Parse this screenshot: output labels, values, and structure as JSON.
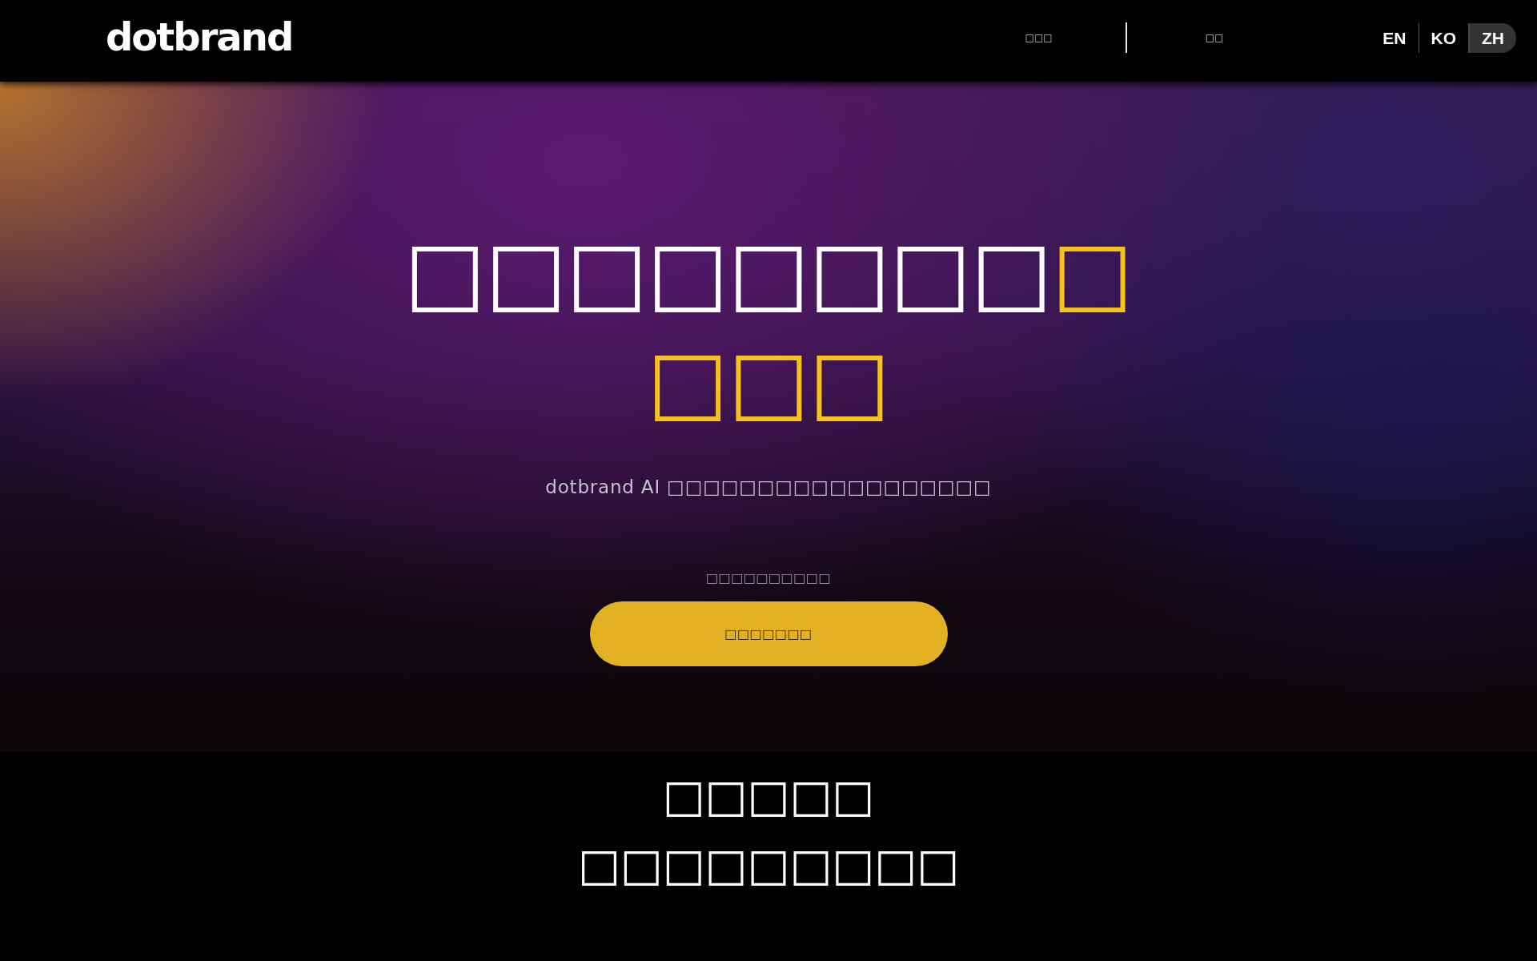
{
  "header": {
    "logo": "dotbrand",
    "nav": [
      {
        "label": "□□□"
      },
      {
        "label": "□□"
      }
    ],
    "languages": [
      {
        "label": "EN",
        "selected": false
      },
      {
        "label": "KO",
        "selected": false
      },
      {
        "label": "ZH",
        "selected": true
      }
    ]
  },
  "hero": {
    "title": {
      "text": "□□□□□□□□",
      "highlight": "□□□□"
    },
    "subtitle": "dotbrand AI □□□□□□□□□□□□□□□□□□",
    "cta_caption": "□□□□□□□□□□",
    "cta_button": "□□□□□□□"
  },
  "section": {
    "heading": [
      "□□□□□",
      "□□□□□□□□□"
    ]
  }
}
